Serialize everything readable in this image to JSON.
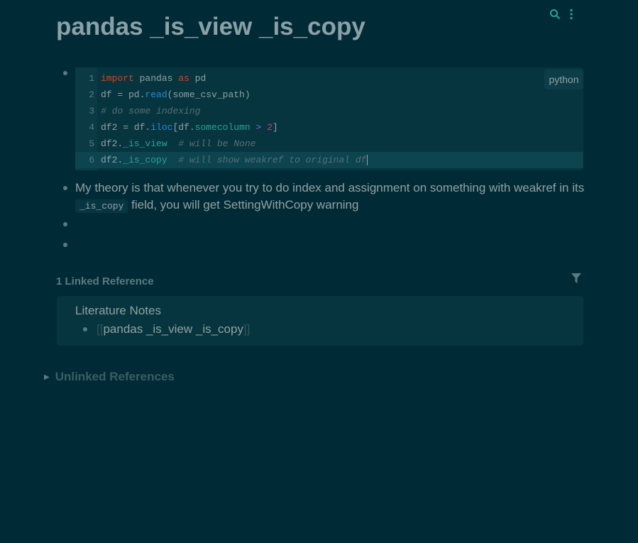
{
  "page": {
    "title": "pandas _is_view _is_copy"
  },
  "top_icons": {
    "search_icon": "search-icon",
    "menu_icon": "more-vertical-icon"
  },
  "code_block": {
    "language": "python",
    "lines": [
      {
        "n": "1",
        "kw1": "import",
        "mid": " pandas ",
        "kw2": "as",
        "end": " pd"
      },
      {
        "n": "2",
        "a": "df = pd.",
        "fn": "read",
        "b": "(some_csv_path)"
      },
      {
        "n": "3",
        "comment": "# do some indexing"
      },
      {
        "n": "4",
        "a": "df2 = df.",
        "fn": "iloc",
        "b": "[df.",
        "attr": "somecolumn",
        "op": " > ",
        "num": "2",
        "c": "]"
      },
      {
        "n": "5",
        "a": "df2.",
        "attr": "_is_view",
        "comment": "  # will be None"
      },
      {
        "n": "6",
        "a": "df2.",
        "attr": "_is_copy",
        "comment": "  # will show weakref to original df"
      }
    ]
  },
  "paragraph": {
    "before": "My theory is that whenever you try to do index and assignment on something with weakref in its ",
    "code": "_is_copy",
    "after": " field, you will get SettingWithCopy warning"
  },
  "linked_refs": {
    "heading": "1 Linked Reference",
    "filter_icon": "filter-icon",
    "page_title": "Literature Notes",
    "link_open": "[[",
    "link_text": "pandas _is_view _is_copy",
    "link_close": "]]"
  },
  "unlinked_refs": {
    "label": "Unlinked References"
  },
  "colors": {
    "background": "#002b36",
    "accent": "#2aa198",
    "keyword": "#cb4b16",
    "function": "#268bd2",
    "number": "#d33682"
  }
}
